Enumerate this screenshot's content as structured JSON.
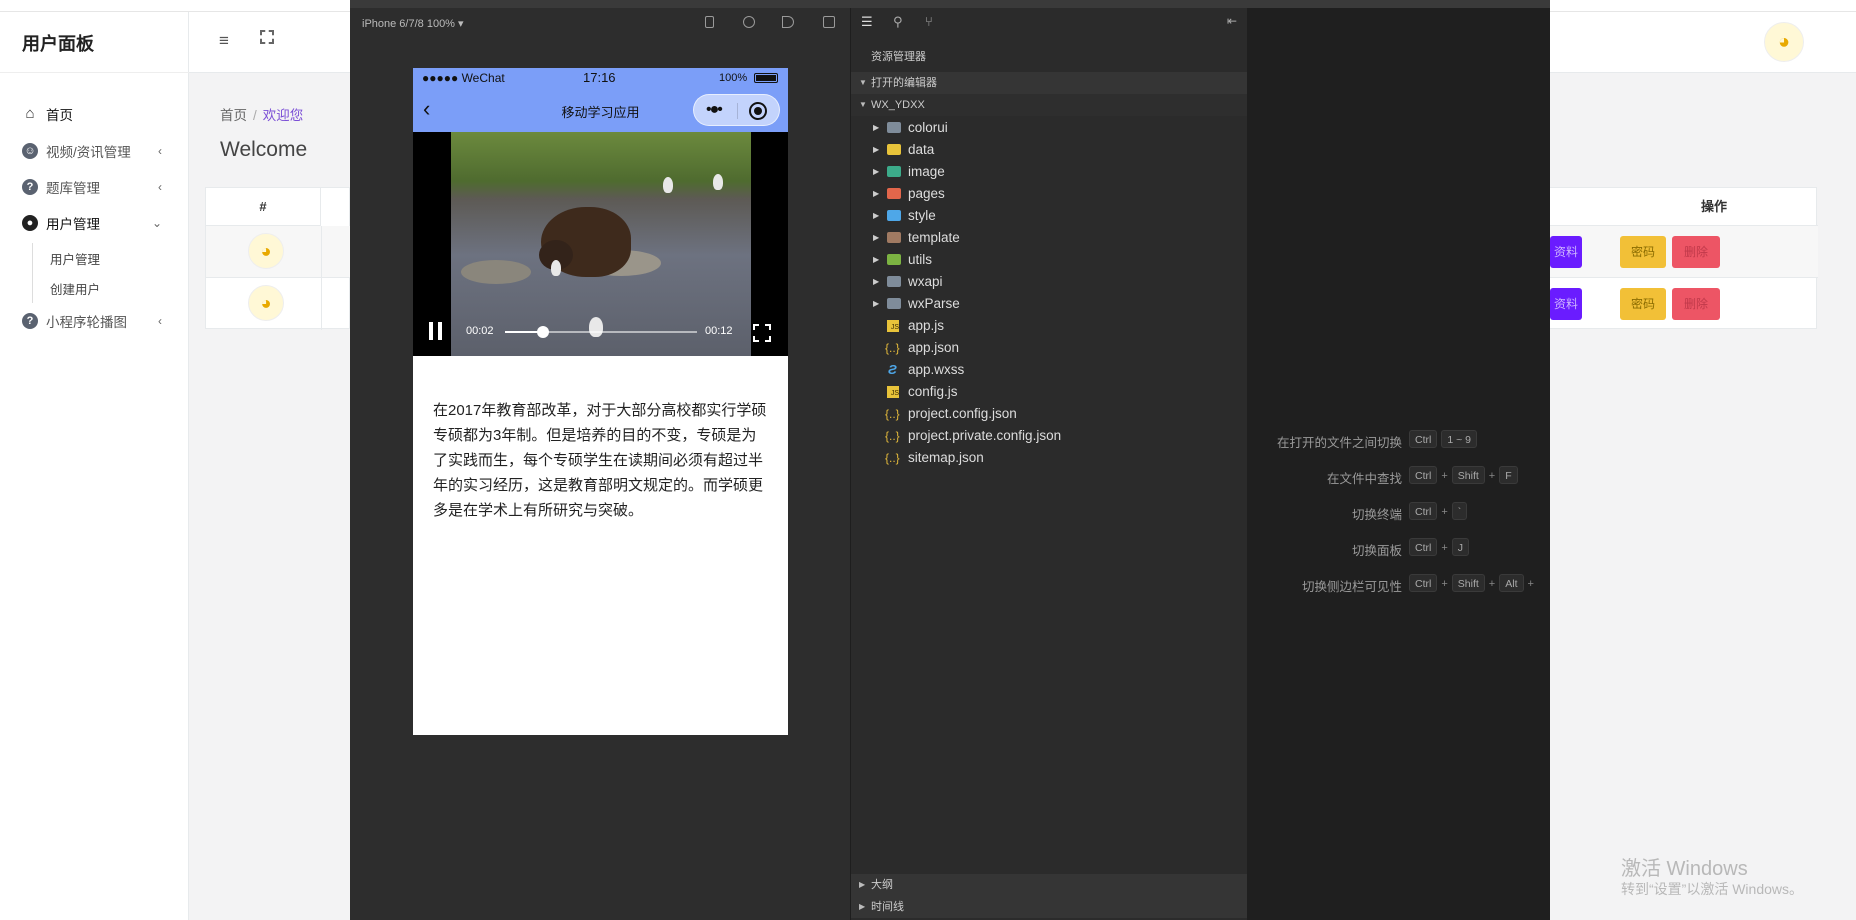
{
  "admin": {
    "brand": "用户面板",
    "nav": [
      {
        "label": "首页",
        "icon": "home-icon",
        "arrow": ""
      },
      {
        "label": "视频/资讯管理",
        "icon": "smile-icon",
        "arrow": "‹"
      },
      {
        "label": "题库管理",
        "icon": "question-icon",
        "arrow": "‹"
      },
      {
        "label": "用户管理",
        "icon": "user-icon",
        "arrow": "⌄"
      },
      {
        "label": "小程序轮播图",
        "icon": "question-icon",
        "arrow": "‹"
      }
    ],
    "subnav": [
      "用户管理",
      "创建用户"
    ],
    "breadcrumb": {
      "home": "首页",
      "sep": "/",
      "current": "欢迎您"
    },
    "welcome": "Welcome",
    "table": {
      "col_hash": "#",
      "col_actions": "操作",
      "buttons": {
        "edit": "资料",
        "pwd": "密码",
        "del": "删除"
      }
    },
    "watermark": {
      "title": "激活 Windows",
      "sub": "转到“设置”以激活 Windows。"
    }
  },
  "simulator": {
    "device": "iPhone 6/7/8 100% ▾",
    "status": {
      "carrier": "●●●●● WeChat",
      "time": "17:16",
      "battery": "100%"
    },
    "nav_title": "移动学习应用",
    "video": {
      "current": "00:02",
      "total": "00:12",
      "progress": 0.2
    },
    "article": "在2017年教育部改革，对于大部分高校都实行学硕专硕都为3年制。但是培养的目的不变，专硕是为了实践而生，每个专硕学生在读期间必须有超过半年的实习经历，这是教育部明文规定的。而学硕更多是在学术上有所研究与突破。"
  },
  "explorer": {
    "title": "资源管理器",
    "open_editors": "打开的编辑器",
    "project": "WX_YDXX",
    "folders": [
      {
        "name": "colorui",
        "color": "#7f8c9a"
      },
      {
        "name": "data",
        "color": "#e8c33a"
      },
      {
        "name": "image",
        "color": "#3cab8a"
      },
      {
        "name": "pages",
        "color": "#e2664b"
      },
      {
        "name": "style",
        "color": "#4ea7e8"
      },
      {
        "name": "template",
        "color": "#a07a62"
      },
      {
        "name": "utils",
        "color": "#7cb342"
      },
      {
        "name": "wxapi",
        "color": "#7f8c9a"
      },
      {
        "name": "wxParse",
        "color": "#7f8c9a"
      }
    ],
    "files": [
      {
        "name": "app.js",
        "type": "js"
      },
      {
        "name": "app.json",
        "type": "json"
      },
      {
        "name": "app.wxss",
        "type": "css"
      },
      {
        "name": "config.js",
        "type": "js"
      },
      {
        "name": "project.config.json",
        "type": "json"
      },
      {
        "name": "project.private.config.json",
        "type": "json"
      },
      {
        "name": "sitemap.json",
        "type": "json"
      }
    ],
    "outline": "大纲",
    "timeline": "时间线"
  },
  "shortcuts": [
    {
      "label": "在打开的文件之间切换",
      "keys": [
        "Ctrl",
        "1 ~ 9"
      ]
    },
    {
      "label": "在文件中查找",
      "keys": [
        "Ctrl",
        "+",
        "Shift",
        "+",
        "F"
      ]
    },
    {
      "label": "切换终端",
      "keys": [
        "Ctrl",
        "+",
        "`"
      ]
    },
    {
      "label": "切换面板",
      "keys": [
        "Ctrl",
        "+",
        "J"
      ]
    },
    {
      "label": "切换侧边栏可见性",
      "keys": [
        "Ctrl",
        "+",
        "Shift",
        "+",
        "Alt",
        "+"
      ]
    }
  ]
}
